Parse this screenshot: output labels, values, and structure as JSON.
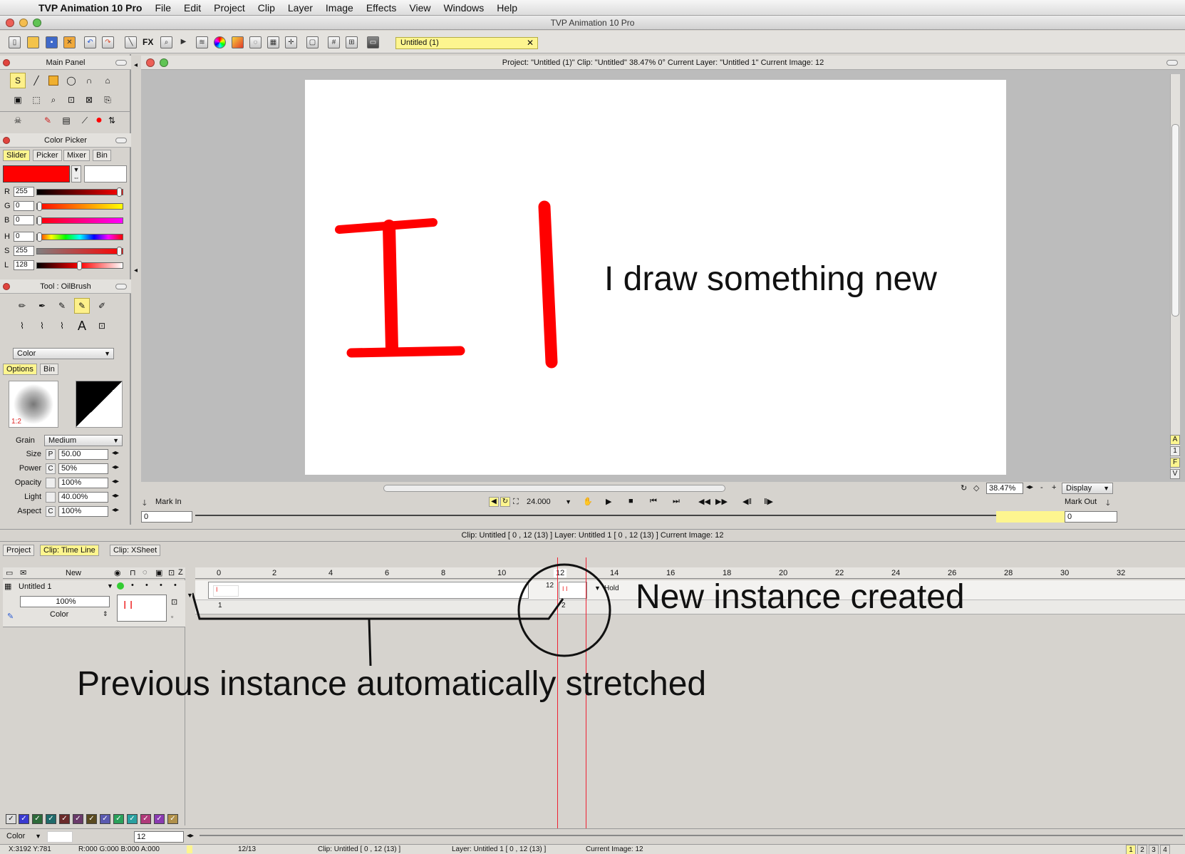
{
  "menubar": {
    "app_name": "TVP Animation 10 Pro",
    "items": [
      "File",
      "Edit",
      "Project",
      "Clip",
      "Layer",
      "Image",
      "Effects",
      "View",
      "Windows",
      "Help"
    ]
  },
  "window": {
    "title": "TVP Animation 10 Pro"
  },
  "toolbar": {
    "fx_label": "FX",
    "project_tab": "Untitled (1)",
    "close_glyph": "✕"
  },
  "main_panel": {
    "title": "Main Panel"
  },
  "color_picker": {
    "title": "Color Picker",
    "tabs": [
      "Slider",
      "Picker",
      "Mixer",
      "Bin"
    ],
    "primary_color": "#ff0000",
    "secondary_color": "#ffffff",
    "sliders": [
      {
        "label": "R",
        "value": "255",
        "level": 1.0
      },
      {
        "label": "G",
        "value": "0",
        "level": 0.0
      },
      {
        "label": "B",
        "value": "0",
        "level": 0.0
      },
      {
        "label": "H",
        "value": "0",
        "level": 0.0
      },
      {
        "label": "S",
        "value": "255",
        "level": 1.0
      },
      {
        "label": "L",
        "value": "128",
        "level": 0.5
      }
    ]
  },
  "tool_panel": {
    "title": "Tool : OilBrush",
    "mode": "Color",
    "tabs": [
      "Options",
      "Bin"
    ],
    "brush_ratio": "1:2",
    "grain_label": "Grain",
    "grain_value": "Medium",
    "props": [
      {
        "label": "Size",
        "mode": "P",
        "value": "50.00"
      },
      {
        "label": "Power",
        "mode": "C",
        "value": "50%"
      },
      {
        "label": "Opacity",
        "mode": "",
        "value": "100%"
      },
      {
        "label": "Light",
        "mode": "",
        "value": "40.00%"
      },
      {
        "label": "Aspect",
        "mode": "C",
        "value": "100%"
      }
    ]
  },
  "canvas": {
    "header": "Project:  \"Untitled (1)\"  Clip: \"Untitled\"   38.47%   0°  Current Layer: \"Untitled 1\"  Current Image: 12",
    "drawn_text": "I draw something new",
    "zoom": "38.47%",
    "display": "Display",
    "mark_in": "Mark In",
    "mark_out": "Mark Out",
    "fps": "24.000",
    "mark_in_value": "0",
    "mark_out_value": "0",
    "side_letters": [
      "A",
      "1",
      "F",
      "V"
    ]
  },
  "timeline": {
    "status": "Clip: Untitled [ 0 , 12  (13) ]       Layer: Untitled 1 [ 0 , 12  (13) ]    Current Image: 12",
    "tabs": [
      "Project",
      "Clip: Time Line",
      "Clip: XSheet"
    ],
    "new_label": "New",
    "layer_name": "Untitled 1",
    "layer_opacity": "100%",
    "layer_mode": "Color",
    "ruler": [
      "0",
      "2",
      "4",
      "6",
      "8",
      "10",
      "12",
      "14",
      "16",
      "18",
      "20",
      "22",
      "24",
      "26",
      "28",
      "30",
      "32"
    ],
    "instance1_label": "1",
    "instance2_label": "2",
    "instance2_marker": "12",
    "hold_label": "Hold",
    "current_frame": "12",
    "bottom_mode": "Color",
    "swatch_colors": [
      "#3a3ad0",
      "#2d6a3a",
      "#1f6a6a",
      "#6a2a2a",
      "#6a3a6a",
      "#5a4a20",
      "#5a5ab0",
      "#2aa05a",
      "#2aa0a0",
      "#b03a7a",
      "#8a3ab0",
      "#b0904a"
    ]
  },
  "annotations": {
    "new_instance": "New instance created",
    "previous_instance": "Previous instance automatically stretched"
  },
  "statusbar": {
    "coords": "X:3192  Y:781",
    "rgba": "R:000 G:000 B:000 A:000",
    "frames": "12/13",
    "clip": "Clip: Untitled [ 0 , 12  (13) ]",
    "layer": "Layer: Untitled 1 [ 0 , 12  (13) ]",
    "current": "Current Image: 12",
    "pages": [
      "1",
      "2",
      "3",
      "4"
    ]
  }
}
